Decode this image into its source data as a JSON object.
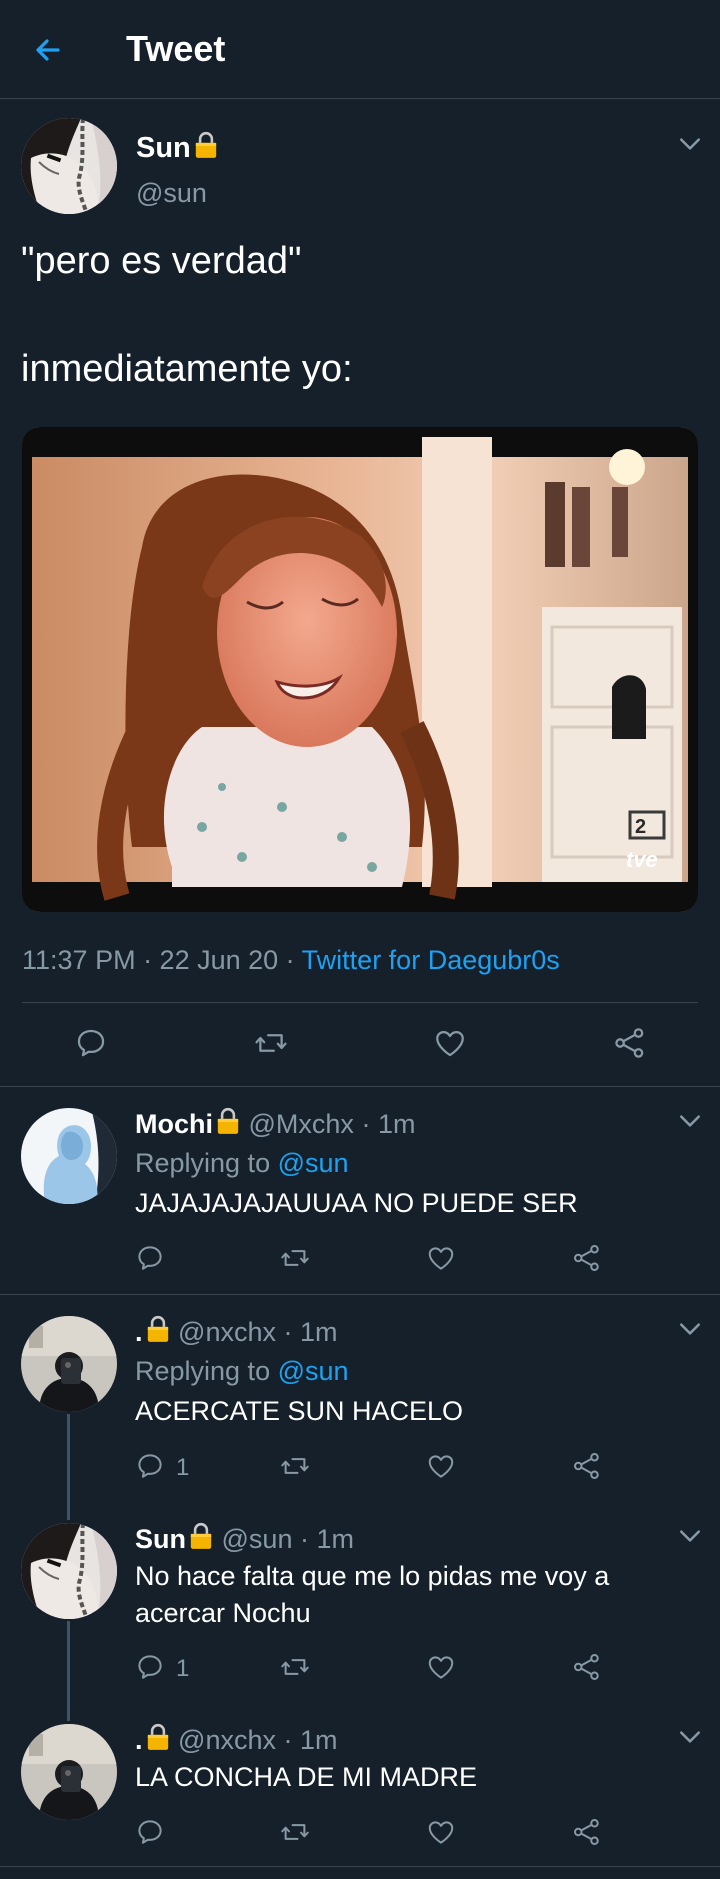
{
  "header": {
    "title": "Tweet"
  },
  "main_tweet": {
    "author_name": "Sun",
    "author_handle": "@sun",
    "text_line1": "\"pero es verdad\"",
    "text_line2": "inmediatamente yo:",
    "timestamp": "11:37 PM · 22 Jun 20 · ",
    "source": "Twitter for Daegubr0s",
    "watermark": "tve"
  },
  "replies": [
    {
      "name": "Mochi",
      "handle": "@Mxchx",
      "time": "· 1m",
      "replying_prefix": "Replying to ",
      "replying_handle": "@sun",
      "text": "JAJAJAJAJAUUAA NO PUEDE SER"
    },
    {
      "name": ".",
      "handle": "@nxchx",
      "time": "· 1m",
      "replying_prefix": "Replying to ",
      "replying_handle": "@sun",
      "text": "ACERCATE SUN HACELO",
      "reply_count": "1"
    },
    {
      "name": "Sun",
      "handle": "@sun",
      "time": "· 1m",
      "text_line1": "No hace falta que me lo pidas me voy a",
      "text_line2": "acercar Nochu",
      "reply_count": "1"
    },
    {
      "name": ".",
      "handle": "@nxchx",
      "time": "· 1m",
      "text": "LA CONCHA DE MI MADRE"
    }
  ],
  "colors": {
    "background": "#15202b",
    "accent": "#1da1f2",
    "muted": "#8899a6",
    "divider": "#38444d",
    "lock": "#f4b400"
  },
  "icons": [
    "back-arrow-icon",
    "chevron-down-icon",
    "lock-icon",
    "reply-icon",
    "retweet-icon",
    "like-icon",
    "share-icon"
  ]
}
